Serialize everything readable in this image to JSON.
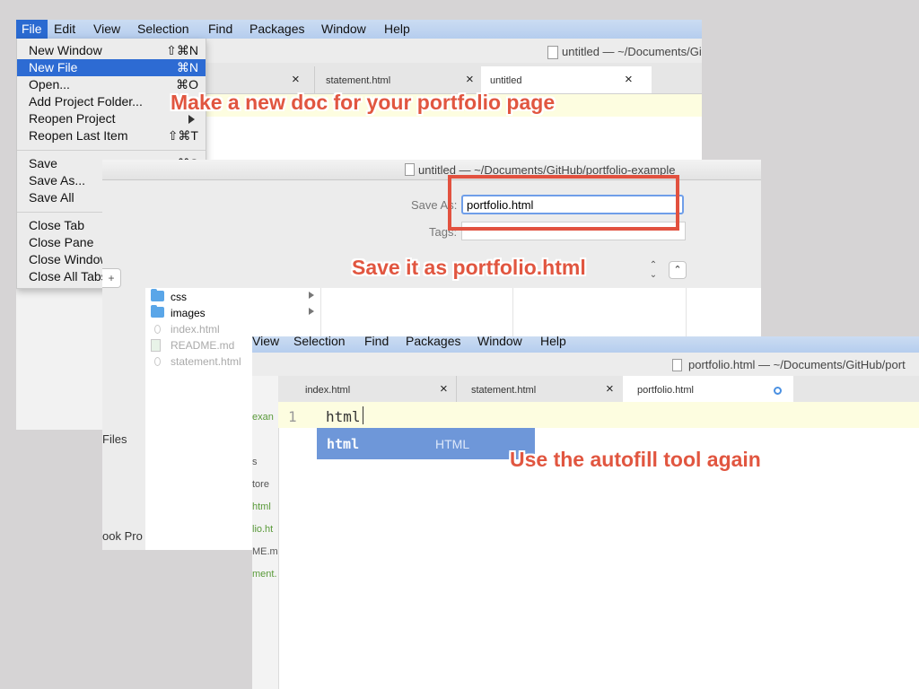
{
  "layer1": {
    "menubar": [
      "File",
      "Edit",
      "View",
      "Selection",
      "Find",
      "Packages",
      "Window",
      "Help"
    ],
    "window_title": "untitled — ~/Documents/GitH",
    "tabs": [
      {
        "label": ""
      },
      {
        "label": "statement.html"
      },
      {
        "label": "untitled"
      }
    ],
    "file_menu": [
      {
        "label": "New Window",
        "shortcut": "⇧⌘N"
      },
      {
        "label": "New File",
        "shortcut": "⌘N"
      },
      {
        "label": "Open...",
        "shortcut": "⌘O"
      },
      {
        "label": "Add Project Folder...",
        "shortcut": "⇧"
      },
      {
        "label": "Reopen Project",
        "shortcut": ""
      },
      {
        "label": "Reopen Last Item",
        "shortcut": "⇧⌘T"
      },
      {
        "label": "Save",
        "shortcut": "⌘S"
      },
      {
        "label": "Save As...",
        "shortcut": ""
      },
      {
        "label": "Save All",
        "shortcut": ""
      },
      {
        "label": "Close Tab",
        "shortcut": ""
      },
      {
        "label": "Close Pane",
        "shortcut": ""
      },
      {
        "label": "Close Window",
        "shortcut": ""
      },
      {
        "label": "Close All Tabs",
        "shortcut": ""
      }
    ],
    "caption": "Make a new doc for your portfolio page"
  },
  "layer2": {
    "window_title": "untitled — ~/Documents/GitHub/portfolio-example",
    "save_as_label": "Save As:",
    "save_as_value": "portfolio.html",
    "tags_label": "Tags:",
    "files": [
      {
        "name": "css",
        "kind": "folder"
      },
      {
        "name": "images",
        "kind": "folder"
      },
      {
        "name": "index.html",
        "kind": "file"
      },
      {
        "name": "README.md",
        "kind": "file"
      },
      {
        "name": "statement.html",
        "kind": "file"
      }
    ],
    "sidebar": {
      "files": "Files",
      "macbook": "ook Pro"
    },
    "caption": "Save it as portfolio.html"
  },
  "layer3": {
    "menubar": [
      "View",
      "Selection",
      "Find",
      "Packages",
      "Window",
      "Help"
    ],
    "window_title": "portfolio.html — ~/Documents/GitHub/port",
    "tabs": [
      {
        "label": "index.html"
      },
      {
        "label": "statement.html"
      },
      {
        "label": "portfolio.html"
      }
    ],
    "tree": [
      "exan",
      "s",
      "tore",
      "html",
      "lio.ht",
      "ME.m",
      "ment."
    ],
    "line_number": "1",
    "code": "html",
    "autocomplete": {
      "word": "html",
      "type": "HTML"
    },
    "caption": "Use the autofill tool again"
  }
}
